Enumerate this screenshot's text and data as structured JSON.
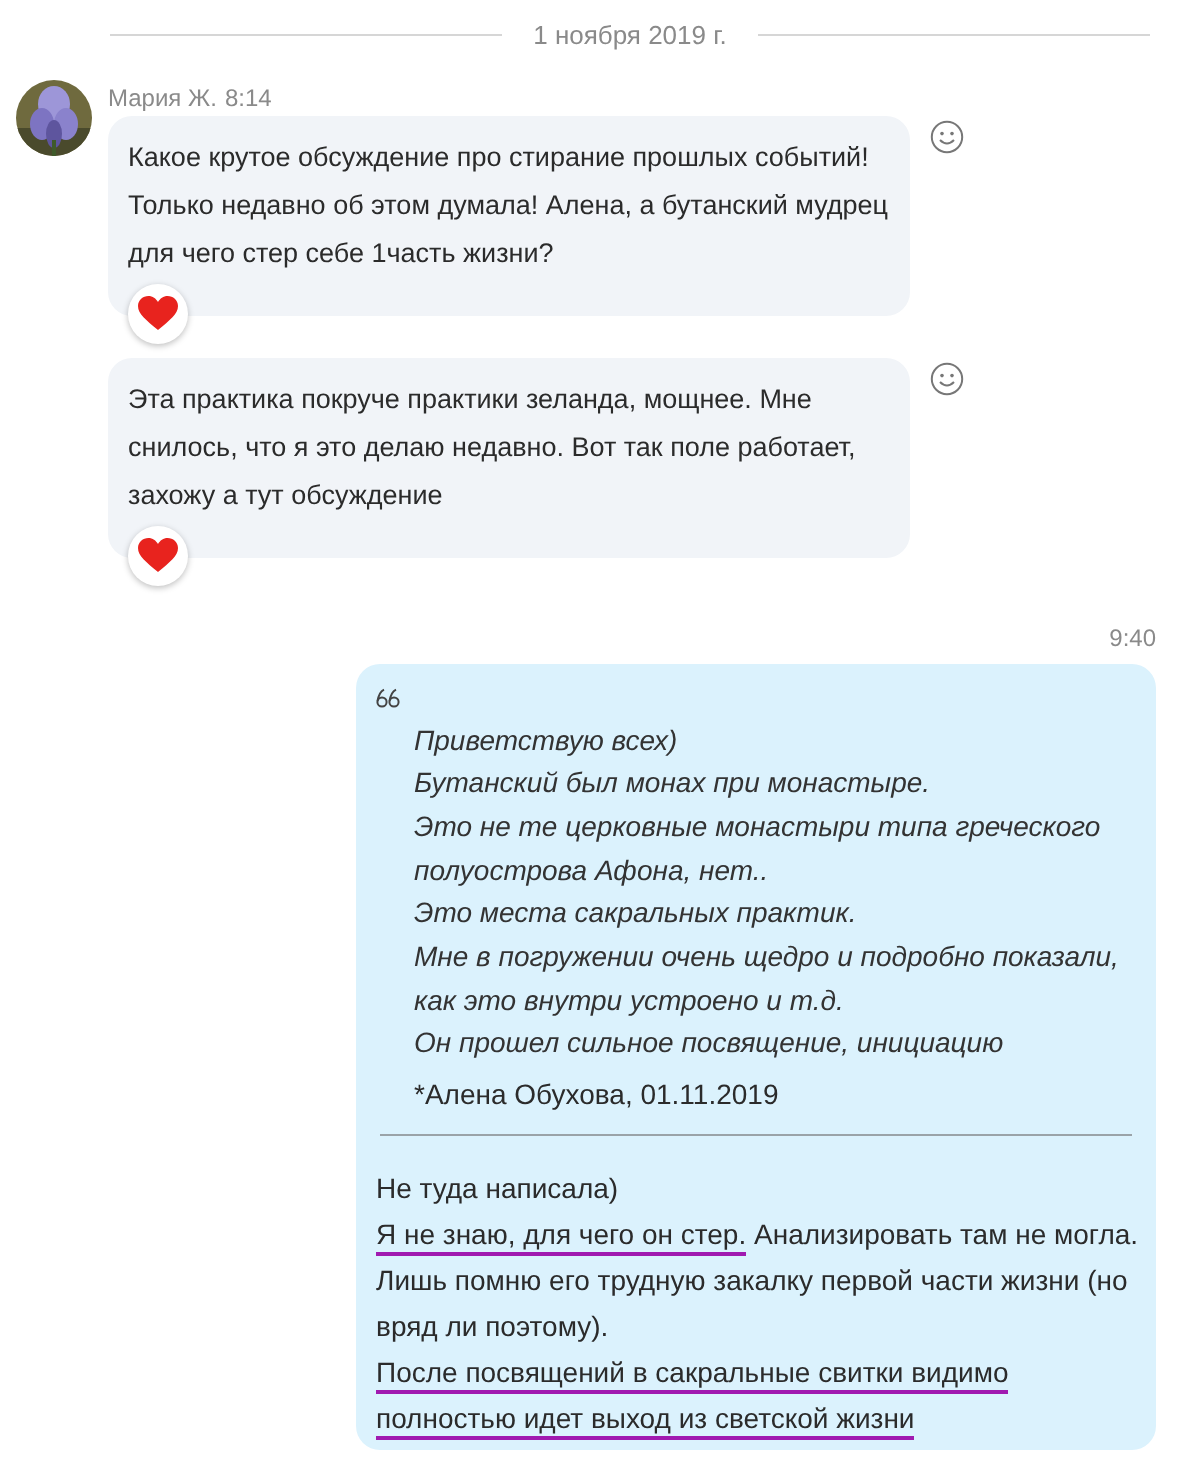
{
  "date_divider": "1 ноября 2019 г.",
  "incoming": {
    "sender": "Мария Ж.",
    "time": "8:14",
    "messages": [
      {
        "lines": [
          "Какое крутое обсуждение про стирание прошлых событий!",
          "Только недавно об этом думала! Алена, а бутанский мудрец",
          "для чего стер себе 1часть жизни?"
        ],
        "reacted": true
      },
      {
        "lines": [
          "Эта практика покруче практики зеланда, мощнее. Мне",
          "снилось, что я это делаю недавно. Вот так поле работает,",
          "захожу а тут обсуждение"
        ],
        "reacted": true
      }
    ]
  },
  "outgoing": {
    "time": "9:40",
    "quote": {
      "lines": [
        "Приветствую всех)",
        "Бутанский был монах при монастыре.",
        "Это не те церковные монастыри типа греческого",
        "полуострова Афона, нет..",
        "Это места сакральных практик.",
        "Мне в погружении очень щедро и подробно показали,",
        "как это внутри устроено и т.д.",
        "Он прошел сильное посвящение, инициацию"
      ],
      "author": "*Алена Обухова, 01.11.2019"
    },
    "reply_lines": [
      [
        {
          "text": "Не туда написала)",
          "underlined": false
        }
      ],
      [
        {
          "text": "Я не знаю, для чего он стер.",
          "underlined": true
        },
        {
          "text": " Анализировать там не могла.",
          "underlined": false
        }
      ],
      [
        {
          "text": "Лишь помню его трудную закалку первой части жизни (но",
          "underlined": false
        }
      ],
      [
        {
          "text": "вряд ли поэтому).",
          "underlined": false
        }
      ],
      [
        {
          "text": "После посвящений в сакральные свитки видимо",
          "underlined": true
        }
      ],
      [
        {
          "text": "полностью идет выход из светской жизни",
          "underlined": true
        }
      ]
    ]
  }
}
